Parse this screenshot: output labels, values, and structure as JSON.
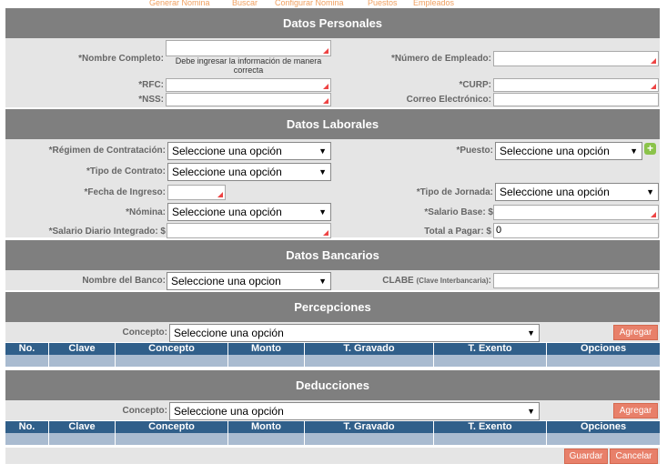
{
  "nav": {
    "items": [
      "Generar Nomina",
      "Buscar",
      "Configurar Nomina",
      "Puestos",
      "Empleados"
    ]
  },
  "personal": {
    "title": "Datos Personales",
    "nombre_label": "*Nombre Completo:",
    "nombre_error": "Debe ingresar la información de manera correcta",
    "numero_label": "*Número de Empleado:",
    "rfc_label": "*RFC:",
    "curp_label": "*CURP:",
    "nss_label": "*NSS:",
    "correo_label": "Correo Electrónico:"
  },
  "laborales": {
    "title": "Datos Laborales",
    "regimen_label": "*Régimen de Contratación:",
    "regimen_value": "Seleccione una opción",
    "puesto_label": "*Puesto:",
    "puesto_value": "Seleccione una opción",
    "tipo_contrato_label": "*Tipo de Contrato:",
    "tipo_contrato_value": "Seleccione una opción",
    "fecha_label": "*Fecha de Ingreso:",
    "jornada_label": "*Tipo de Jornada:",
    "jornada_value": "Seleccione una opción",
    "nomina_label": "*Nómina:",
    "nomina_value": "Seleccione una opción",
    "salario_base_label": "*Salario Base: $",
    "sdi_label": "*Salario Diario Integrado: $",
    "total_label": "Total a Pagar: $",
    "total_value": "0"
  },
  "bancarios": {
    "title": "Datos Bancarios",
    "banco_label": "Nombre del Banco:",
    "banco_value": "Seleccione una opcion",
    "clabe_label": "CLABE",
    "clabe_sub": "(Clave Interbancaria)",
    "clabe_colon": ":"
  },
  "percepciones": {
    "title": "Percepciones",
    "concepto_label": "Concepto:",
    "concepto_value": "Seleccione una opción",
    "agregar": "Agregar",
    "columns": [
      "No.",
      "Clave",
      "Concepto",
      "Monto",
      "T. Gravado",
      "T. Exento",
      "Opciones"
    ]
  },
  "deducciones": {
    "title": "Deducciones",
    "concepto_label": "Concepto:",
    "concepto_value": "Seleccione una opción",
    "agregar": "Agregar",
    "columns": [
      "No.",
      "Clave",
      "Concepto",
      "Monto",
      "T. Gravado",
      "T. Exento",
      "Opciones"
    ]
  },
  "actions": {
    "guardar": "Guardar",
    "cancelar": "Cancelar"
  },
  "colors": {
    "section_header": "#7f7f7f",
    "band": "#e5e5e5",
    "table_header": "#305f8a",
    "table_row": "#a9bbd0",
    "button": "#e8806a",
    "nav_link": "#f0a060"
  }
}
